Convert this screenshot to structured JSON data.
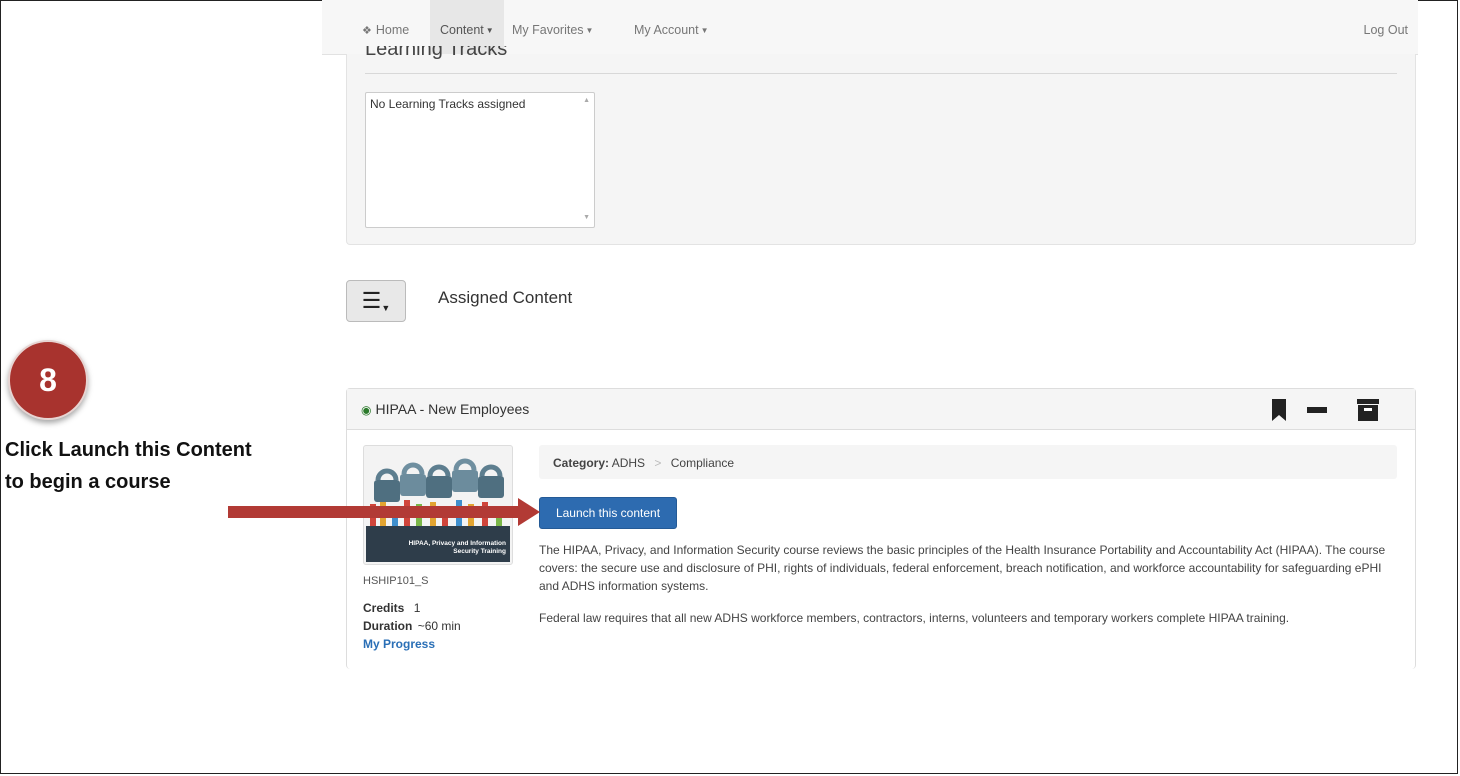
{
  "nav": {
    "home": "Home",
    "content": "Content",
    "favorites": "My Favorites",
    "account": "My Account",
    "logout": "Log Out"
  },
  "learning_tracks": {
    "title": "Learning Tracks",
    "empty_text": "No Learning Tracks assigned"
  },
  "assigned": {
    "title": "Assigned Content"
  },
  "course": {
    "title": "HIPAA - New Employees",
    "thumbnail_text": "HIPAA, Privacy and Information Security Training",
    "code": "HSHIP101_S",
    "credits_label": "Credits",
    "credits_value": "1",
    "duration_label": "Duration",
    "duration_value": "~60 min",
    "progress_link": "My Progress",
    "category_label": "Category:",
    "category_parent": "ADHS",
    "category_child": "Compliance",
    "launch_label": "Launch this content",
    "description_1": "The HIPAA, Privacy, and Information Security course reviews the basic principles of the Health Insurance Portability and Accountability Act (HIPAA). The course covers: the secure use and disclosure of PHI, rights of individuals, federal enforcement, breach notification, and workforce accountability for safeguarding ePHI and ADHS information systems.",
    "description_2": "Federal law requires that all new ADHS workforce members, contractors, interns, volunteers and temporary workers complete HIPAA training."
  },
  "annotation": {
    "step": "8",
    "line1": "Click Launch this Content",
    "line2": "to begin a course",
    "color": "#b23a35"
  },
  "colors": {
    "primary_button": "#2d6bb0",
    "link": "#2a6fb6",
    "panel_bg": "#f5f5f5"
  }
}
